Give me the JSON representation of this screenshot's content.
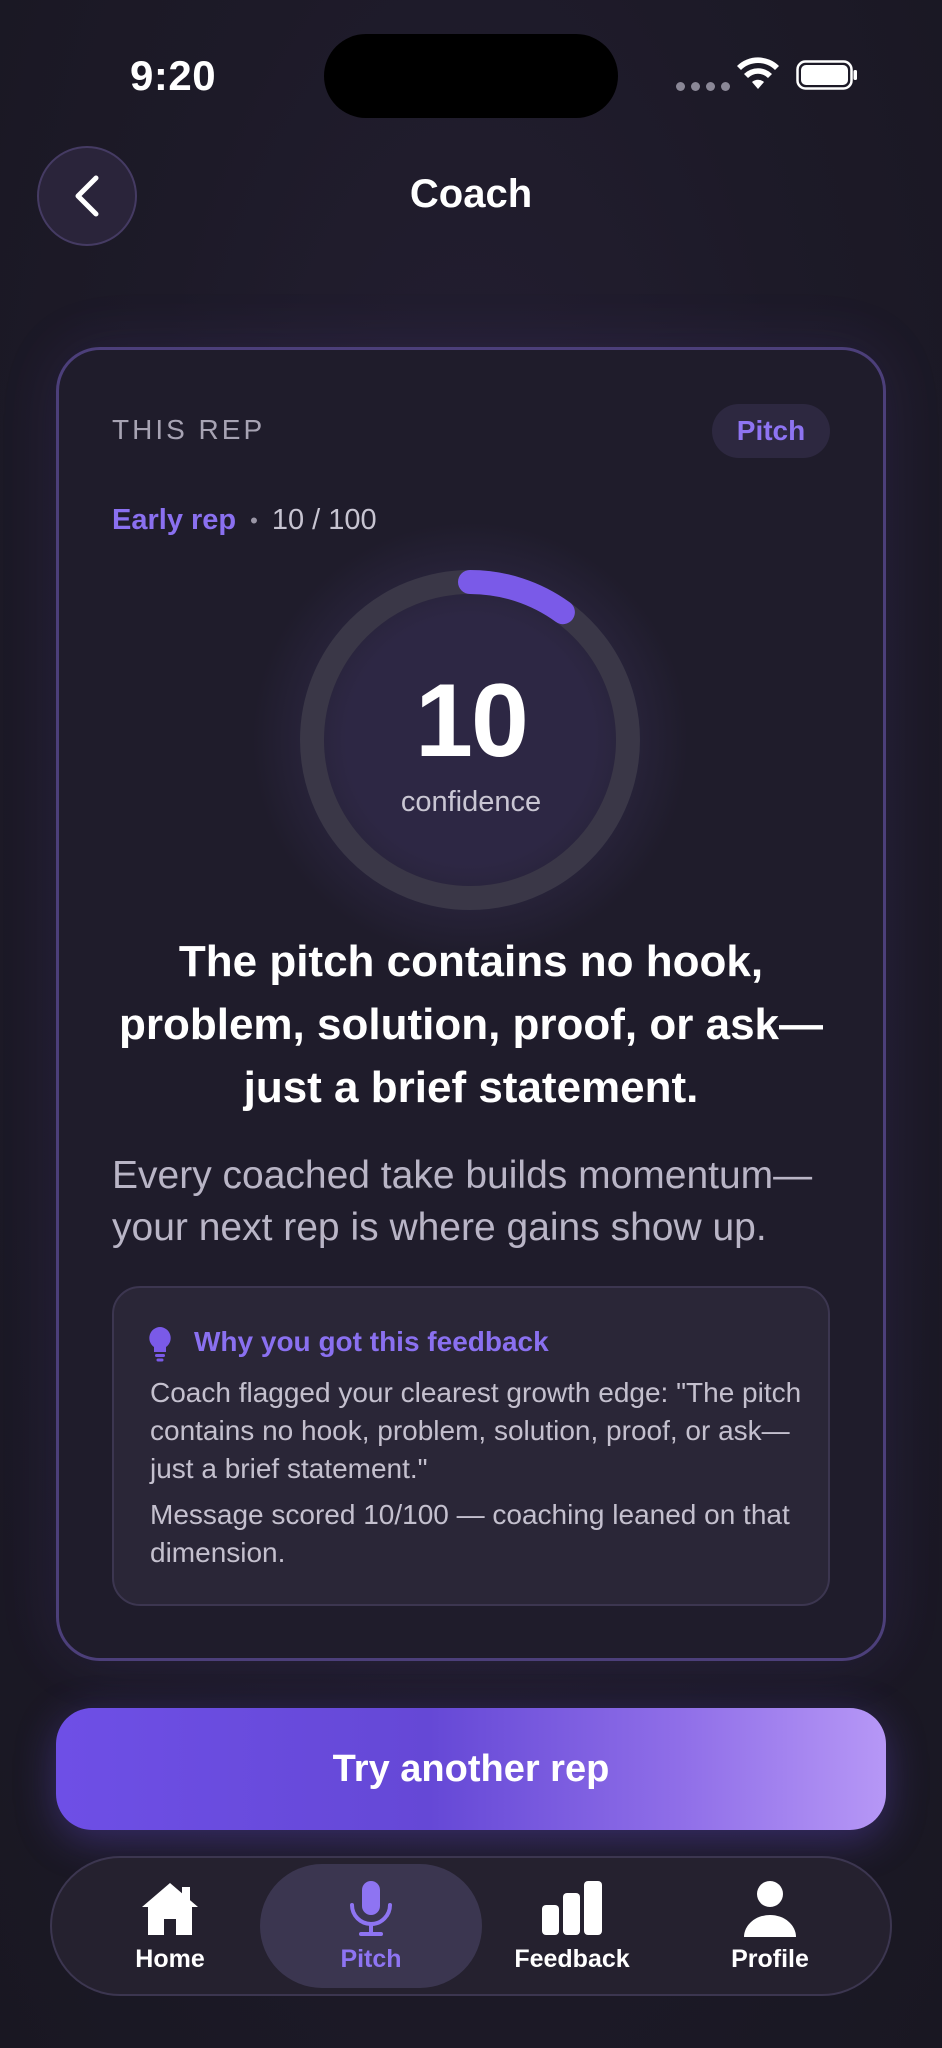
{
  "status_bar": {
    "time": "9:20"
  },
  "header": {
    "title": "Coach"
  },
  "card": {
    "section_label": "THIS REP",
    "category_badge": "Pitch",
    "rep_label": "Early rep",
    "score_text": "10 / 100",
    "confidence_value": "10",
    "confidence_fraction": 0.1,
    "confidence_label": "confidence",
    "headline": "The pitch contains no hook, problem, solution, proof, or ask—just a brief statement.",
    "subtext": "Every coached take builds momentum—your next rep is where gains show up.",
    "why": {
      "title": "Why you got this feedback",
      "body": "Coach flagged your clearest growth edge: \"The pitch contains no hook, problem, solution, proof, or ask—just a brief statement.\"",
      "note": "Message scored 10/100 — coaching leaned on that dimension."
    }
  },
  "cta": {
    "label": "Try another rep"
  },
  "tabs": [
    {
      "label": "Home",
      "icon": "house-icon",
      "active": false
    },
    {
      "label": "Pitch",
      "icon": "microphone-icon",
      "active": true
    },
    {
      "label": "Feedback",
      "icon": "bar-chart-icon",
      "active": false
    },
    {
      "label": "Profile",
      "icon": "person-icon",
      "active": false
    }
  ],
  "colors": {
    "accent": "#8a70f0",
    "background": "#1d1a28",
    "card_border": "#4c3f7a"
  }
}
